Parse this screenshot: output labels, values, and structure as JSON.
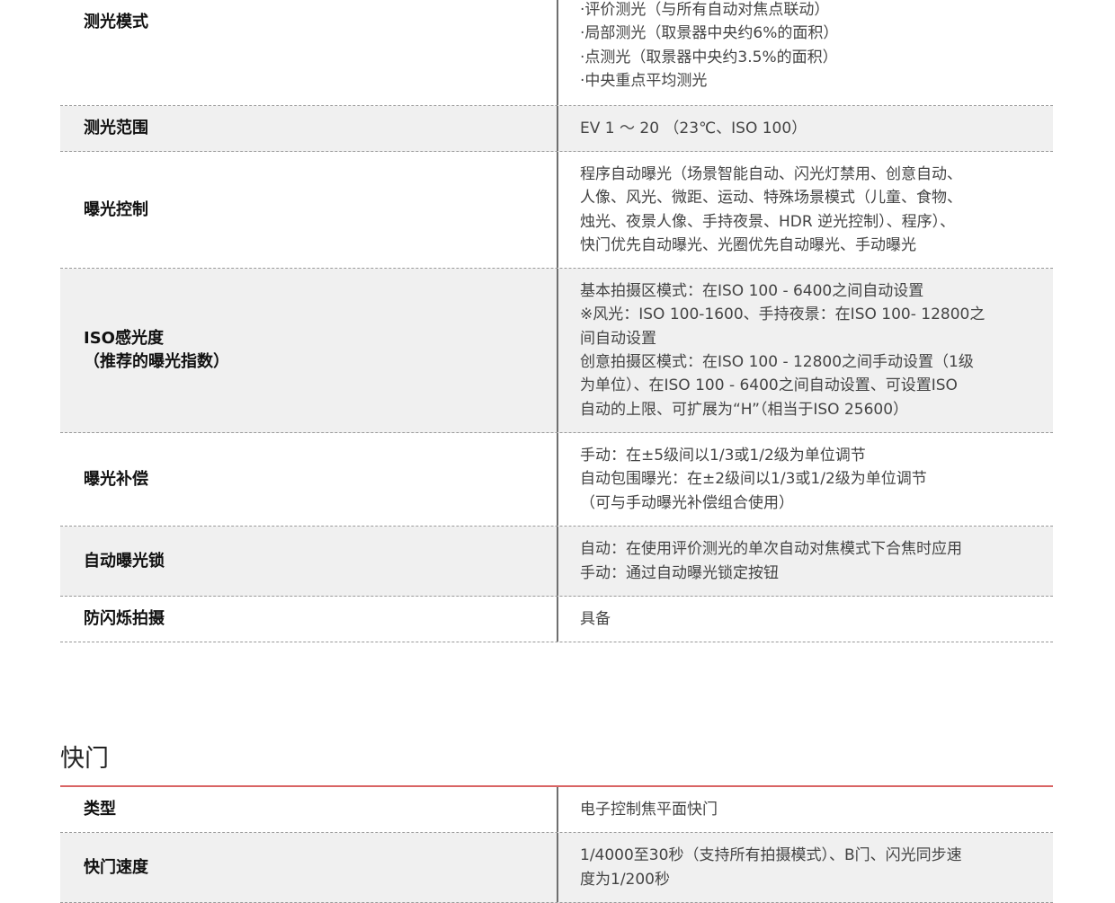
{
  "exposure_rows": [
    {
      "label": [
        "测光模式"
      ],
      "value": [
        "·评价测光（与所有自动对焦点联动）",
        "·局部测光（取景器中央约6%的面积）",
        "·点测光（取景器中央约3.5%的面积）",
        "·中央重点平均测光"
      ]
    },
    {
      "label": [
        "测光范围"
      ],
      "value": [
        "EV 1 ～ 20 （23℃、ISO 100）"
      ]
    },
    {
      "label": [
        "曝光控制"
      ],
      "value": [
        "程序自动曝光（场景智能自动、闪光灯禁用、创意自动、",
        "人像、风光、微距、运动、特殊场景模式（儿童、食物、",
        "烛光、夜景人像、手持夜景、HDR 逆光控制）、程序）、",
        "快门优先自动曝光、光圈优先自动曝光、手动曝光"
      ]
    },
    {
      "label": [
        "ISO感光度",
        "（推荐的曝光指数）"
      ],
      "value": [
        "基本拍摄区模式：在ISO 100 - 6400之间自动设置",
        "※风光：ISO 100-1600、手持夜景：在ISO 100- 12800之",
        "间自动设置",
        "创意拍摄区模式：在ISO 100 - 12800之间手动设置（1级",
        "为单位）、在ISO 100 - 6400之间自动设置、可设置ISO",
        "自动的上限、可扩展为“H”（相当于ISO 25600）"
      ]
    },
    {
      "label": [
        "曝光补偿"
      ],
      "value": [
        "手动：在±5级间以1/3或1/2级为单位调节",
        "自动包围曝光：在±2级间以1/3或1/2级为单位调节",
        "（可与手动曝光补偿组合使用）"
      ]
    },
    {
      "label": [
        "自动曝光锁"
      ],
      "value": [
        "自动：在使用评价测光的单次自动对焦模式下合焦时应用",
        "手动：通过自动曝光锁定按钮"
      ]
    },
    {
      "label": [
        "防闪烁拍摄"
      ],
      "value": [
        "具备"
      ]
    }
  ],
  "shutter_section": {
    "title": "快门",
    "rows": [
      {
        "label": [
          "类型"
        ],
        "value": [
          "电子控制焦平面快门"
        ]
      },
      {
        "label": [
          "快门速度"
        ],
        "value": [
          "1/4000至30秒（支持所有拍摄模式）、B门、闪光同步速",
          "度为1/200秒"
        ]
      }
    ]
  },
  "colors": {
    "section_rule": "#d96464",
    "row_shade": "#f0f0f0",
    "divider": "#6f6f6f"
  }
}
